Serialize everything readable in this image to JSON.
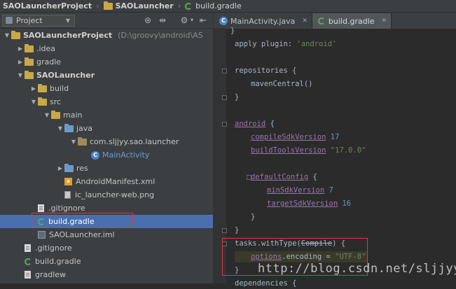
{
  "breadcrumb": {
    "items": [
      "SAOLauncherProject",
      "SAOLauncher",
      "build.gradle"
    ],
    "separator": "›"
  },
  "panel": {
    "selector_label": "Project",
    "tools": [
      "settings-icon",
      "split-icon",
      "gear-icon",
      "collapse-icon"
    ]
  },
  "tree": [
    {
      "label": "SAOLauncherProject",
      "path": "(D:\\groovy\\android\\AS",
      "icon": "folder",
      "expanded": true,
      "depth": 0,
      "bold": true
    },
    {
      "label": ".idea",
      "icon": "folder",
      "expanded": false,
      "depth": 1
    },
    {
      "label": "gradle",
      "icon": "folder",
      "expanded": false,
      "depth": 1
    },
    {
      "label": "SAOLauncher",
      "icon": "folder",
      "expanded": true,
      "depth": 1,
      "bold": true
    },
    {
      "label": "build",
      "icon": "folder",
      "expanded": false,
      "depth": 2
    },
    {
      "label": "src",
      "icon": "folder",
      "expanded": true,
      "depth": 2
    },
    {
      "label": "main",
      "icon": "folder",
      "expanded": true,
      "depth": 3
    },
    {
      "label": "java",
      "icon": "folder-source",
      "expanded": true,
      "depth": 4
    },
    {
      "label": "com.sljjyy.sao.launcher",
      "icon": "package",
      "expanded": true,
      "depth": 5
    },
    {
      "label": "MainActivity",
      "icon": "class",
      "depth": 6,
      "color": "#6b9bd8"
    },
    {
      "label": "res",
      "icon": "folder-source",
      "expanded": false,
      "depth": 4
    },
    {
      "label": "AndroidManifest.xml",
      "icon": "xml",
      "depth": 4
    },
    {
      "label": "ic_launcher-web.png",
      "icon": "image",
      "depth": 4
    },
    {
      "label": ".gitignore",
      "icon": "text",
      "depth": 2
    },
    {
      "label": "build.gradle",
      "icon": "gradle",
      "depth": 2,
      "selected": true
    },
    {
      "label": "SAOLauncher.iml",
      "icon": "iml",
      "depth": 2
    },
    {
      "label": ".gitignore",
      "icon": "text",
      "depth": 1
    },
    {
      "label": "build.gradle",
      "icon": "gradle",
      "depth": 1
    },
    {
      "label": "gradlew",
      "icon": "text",
      "depth": 1
    }
  ],
  "tabs": [
    {
      "label": "MainActivity.java",
      "icon": "class",
      "active": false
    },
    {
      "label": "build.gradle",
      "icon": "gradle",
      "active": true
    }
  ],
  "code": {
    "apply_kw": "apply plugin",
    "apply_val": "'android'",
    "repositories": "repositories",
    "mavenCentral": "mavenCentral",
    "android": "android",
    "compileSdkVersion": "compileSdkVersion",
    "compileSdk_val": "17",
    "buildToolsVersion": "buildToolsVersion",
    "buildTools_val": "\"17.0.0\"",
    "defaultConfig": "defaultConfig",
    "minSdkVersion": "minSdkVersion",
    "minSdk_val": "7",
    "targetSdkVersion": "targetSdkVersion",
    "targetSdk_val": "16",
    "tasks": "tasks",
    "withType": "withType",
    "compile": "Compile",
    "options": "options",
    "encoding": "encoding",
    "encoding_val": "\"UTF-8\"",
    "dependencies": "dependencies"
  },
  "watermark": "http://blog.csdn.net/sljjyy",
  "colors": {
    "selection": "#4b6eaf",
    "highlight_box": "#e0393a",
    "keyword": "#cc7832",
    "string": "#6a8759",
    "number": "#6897bb",
    "field": "#9876aa"
  }
}
